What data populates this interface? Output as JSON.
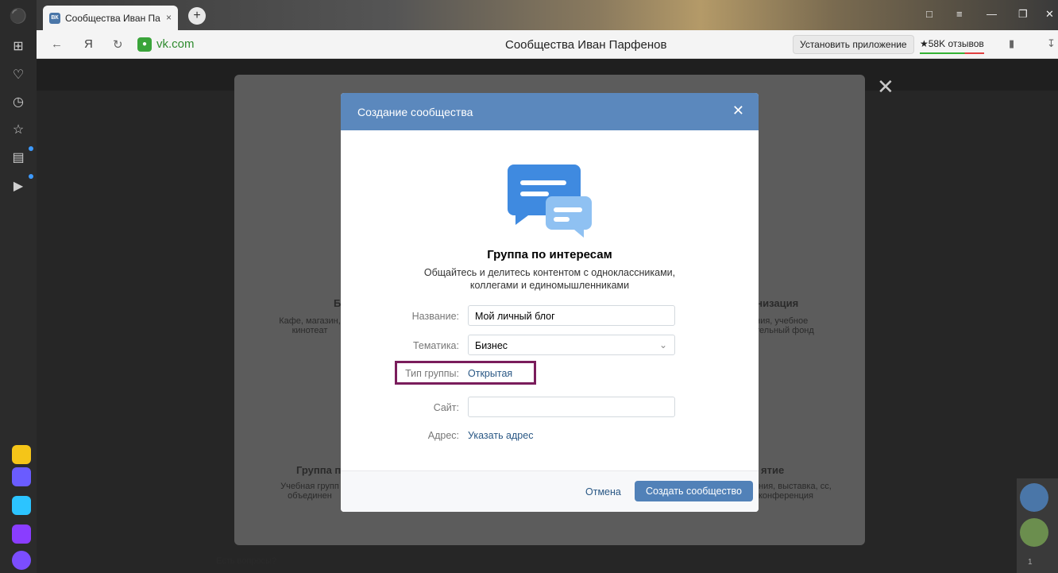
{
  "browser": {
    "tab_title": "Сообщества Иван Пар",
    "tab_icon": "ВК",
    "close_tab": "×",
    "new_tab": "+",
    "logo_letter": "Я",
    "domain": "vk.com",
    "page_title": "Сообщества Иван Парфенов",
    "install_label": "Установить приложение",
    "reviews_label": "★58K отзывов"
  },
  "backdrop": {
    "cards": [
      {
        "title": "Б",
        "desc": "Кафе, магазин, кинотеат"
      },
      {
        "title": "анизация",
        "desc": "ания, учебное ительный фонд"
      },
      {
        "title": "Группа п",
        "desc": "Учебная групп объединен"
      },
      {
        "title": "ятие",
        "desc": "ния, выставка, сс, конференция"
      }
    ],
    "footer_text": "Есть вопросы?",
    "counter": "1"
  },
  "dialog": {
    "title": "Создание сообщества",
    "close": "✕",
    "group_title": "Группа по интересам",
    "group_desc": "Общайтесь и делитесь контентом с одноклассниками, коллегами и единомышленниками",
    "name_label": "Название:",
    "name_value": "Мой личный блог",
    "topic_label": "Тематика:",
    "topic_value": "Бизнес",
    "type_label": "Тип группы:",
    "type_value": "Открытая",
    "site_label": "Сайт:",
    "site_value": "",
    "address_label": "Адрес:",
    "address_link": "Указать адрес",
    "cancel_label": "Отмена",
    "create_label": "Создать сообщество"
  },
  "colors": {
    "header": "#5b88bd",
    "primary_button": "#5181b8",
    "link": "#2a5885",
    "highlight": "#7a1d5c"
  }
}
